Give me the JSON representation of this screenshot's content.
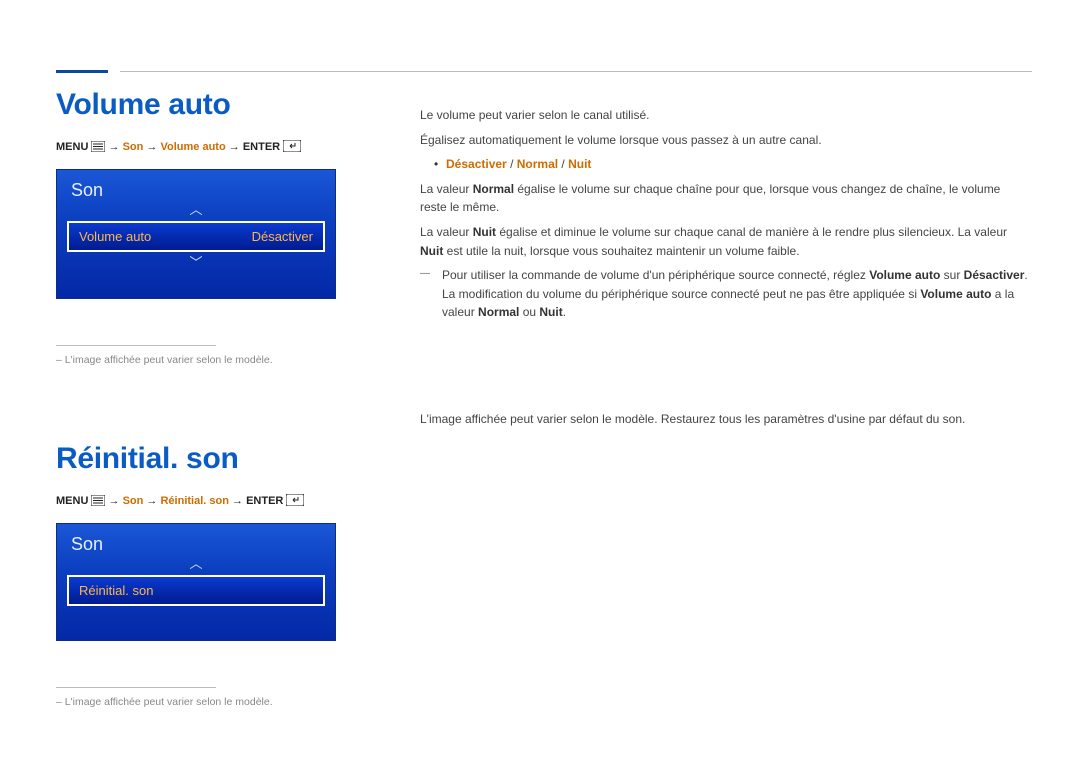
{
  "section1": {
    "title": "Volume auto",
    "menu_prefix": "MENU",
    "path_parts": {
      "arrow": " → ",
      "p1": "Son",
      "p2": "Volume auto",
      "enter": "ENTER"
    },
    "tv": {
      "header": "Son",
      "row_label": "Volume auto",
      "row_value": "Désactiver"
    },
    "footnote": "L'image affichée peut varier selon le modèle."
  },
  "right1": {
    "p1": "Le volume peut varier selon le canal utilisé.",
    "p2": "Égalisez automatiquement le volume lorsque vous passez à un autre canal.",
    "options": {
      "a": "Désactiver",
      "b": "Normal",
      "c": "Nuit"
    },
    "p3a": "La valeur ",
    "p3b": "Normal",
    "p3c": " égalise le volume sur chaque chaîne pour que, lorsque vous changez de chaîne, le volume reste le même.",
    "p4a": "La valeur ",
    "p4b": "Nuit",
    "p4c": " égalise et diminue le volume sur chaque canal de manière à le rendre plus silencieux. La valeur ",
    "p4d": "Nuit",
    "p4e": " est utile la nuit, lorsque vous souhaitez maintenir un volume faible.",
    "note_a": "Pour utiliser la commande de volume d'un périphérique source connecté, réglez ",
    "note_b": "Volume auto",
    "note_c": " sur ",
    "note_d": "Désactiver",
    "note_e": ". La modification du volume du périphérique source connecté peut ne pas être appliquée si ",
    "note_f": "Volume auto",
    "note_g": " a la valeur ",
    "note_h": "Normal",
    "note_i": " ou ",
    "note_j": "Nuit",
    "note_k": "."
  },
  "section2": {
    "title": "Réinitial. son",
    "menu_prefix": "MENU",
    "path_parts": {
      "arrow": " → ",
      "p1": "Son",
      "p2": "Réinitial. son",
      "enter": "ENTER"
    },
    "tv": {
      "header": "Son",
      "row_label": "Réinitial. son"
    },
    "footnote": "L'image affichée peut varier selon le modèle."
  },
  "right2": {
    "p1": "L'image affichée peut varier selon le modèle. Restaurez tous les paramètres d'usine par défaut du son."
  }
}
